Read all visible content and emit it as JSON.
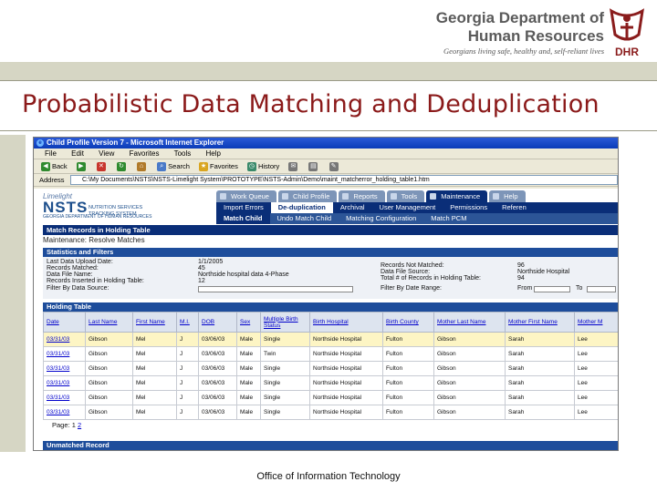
{
  "slide": {
    "org_line1": "Georgia Department of",
    "org_line2": "Human Resources",
    "tagline": "Georgians living safe, healthy and, self-reliant lives",
    "logo_text": "DHR",
    "title": "Probabilistic Data Matching and Deduplication",
    "footer": "Office of Information Technology"
  },
  "browser": {
    "window_title": "Child Profile Version 7 - Microsoft Internet Explorer",
    "menu": [
      "File",
      "Edit",
      "View",
      "Favorites",
      "Tools",
      "Help"
    ],
    "toolbar": {
      "back": "Back",
      "search": "Search",
      "favorites": "Favorites",
      "history": "History"
    },
    "address_label": "Address",
    "address": "C:\\My Documents\\NSTS\\NSTS-Limelight System\\PROTOTYPE\\NSTS-Admin\\Demo\\maint_matcherror_holding_table1.htm"
  },
  "app": {
    "logo": {
      "limelight": "Limelight",
      "nsts": "NSTS",
      "sub1": "NUTRITION SERVICES",
      "sub2": "TRACKING SYSTEM",
      "sub3": "GEORGIA DEPARTMENT OF HUMAN RESOURCES"
    },
    "tabs": [
      {
        "label": "Work Queue",
        "active": false
      },
      {
        "label": "Child Profile",
        "active": false
      },
      {
        "label": "Reports",
        "active": false
      },
      {
        "label": "Tools",
        "active": false
      },
      {
        "label": "Maintenance",
        "active": true
      },
      {
        "label": "Help",
        "active": false
      }
    ],
    "subnav1": [
      {
        "label": "Import Errors",
        "active": false
      },
      {
        "label": "De-duplication",
        "active": true
      },
      {
        "label": "Archival",
        "active": false
      },
      {
        "label": "User Management",
        "active": false
      },
      {
        "label": "Permissions",
        "active": false
      },
      {
        "label": "Referen",
        "active": false
      }
    ],
    "subnav2": [
      {
        "label": "Match Child",
        "active": true
      },
      {
        "label": "Undo Match Child",
        "active": false
      },
      {
        "label": "Matching Configuration",
        "active": false
      },
      {
        "label": "Match PCM",
        "active": false
      }
    ],
    "section_title": "Match Records in Holding Table",
    "breadcrumb": "Maintenance: Resolve Matches",
    "stats": {
      "heading": "Statistics and Filters",
      "last_upload_label": "Last Data Upload Date:",
      "last_upload_value": "1/1/2005",
      "records_matched_label": "Records Matched:",
      "records_matched_value": "45",
      "data_file_name_label": "Data File Name:",
      "data_file_name_value": "Northside hospital data 4-Phase",
      "records_inserted_label": "Records Inserted in Holding Table:",
      "records_inserted_value": "12",
      "filter_source_label": "Filter By Data Source:",
      "records_not_matched_label": "Records Not Matched:",
      "records_not_matched_value": "96",
      "data_file_source_label": "Data File Source:",
      "data_file_source_value": "Northside Hospital",
      "total_records_label": "Total # of Records in Holding Table:",
      "total_records_value": "94",
      "filter_date_label": "Filter By Date Range:",
      "from_label": "From",
      "to_label": "To"
    },
    "holding_table": {
      "heading": "Holding Table",
      "columns": [
        "Date",
        "Last Name",
        "First Name",
        "M.I.",
        "DOB",
        "Sex",
        "Multiple Birth Status",
        "Birth Hospital",
        "Birth County",
        "Mother Last Name",
        "Mother First Name",
        "Mother M"
      ],
      "rows": [
        [
          "03/31/03",
          "Gibson",
          "Mel",
          "J",
          "03/06/03",
          "Male",
          "Single",
          "Northside Hospital",
          "Fulton",
          "Gibson",
          "Sarah",
          "Lee"
        ],
        [
          "03/31/03",
          "Gibson",
          "Mel",
          "J",
          "03/06/03",
          "Male",
          "Twin",
          "Northside Hospital",
          "Fulton",
          "Gibson",
          "Sarah",
          "Lee"
        ],
        [
          "03/31/03",
          "Gibson",
          "Mel",
          "J",
          "03/06/03",
          "Male",
          "Single",
          "Northside Hospital",
          "Fulton",
          "Gibson",
          "Sarah",
          "Lee"
        ],
        [
          "03/31/03",
          "Gibson",
          "Mel",
          "J",
          "03/06/03",
          "Male",
          "Single",
          "Northside Hospital",
          "Fulton",
          "Gibson",
          "Sarah",
          "Lee"
        ],
        [
          "03/31/03",
          "Gibson",
          "Mel",
          "J",
          "03/06/03",
          "Male",
          "Single",
          "Northside Hospital",
          "Fulton",
          "Gibson",
          "Sarah",
          "Lee"
        ],
        [
          "03/31/03",
          "Gibson",
          "Mel",
          "J",
          "03/06/03",
          "Male",
          "Single",
          "Northside Hospital",
          "Fulton",
          "Gibson",
          "Sarah",
          "Lee"
        ]
      ],
      "pager_label": "Page:",
      "pager_current": "1",
      "pager_next": "2"
    },
    "unmatched_heading": "Unmatched Record"
  }
}
